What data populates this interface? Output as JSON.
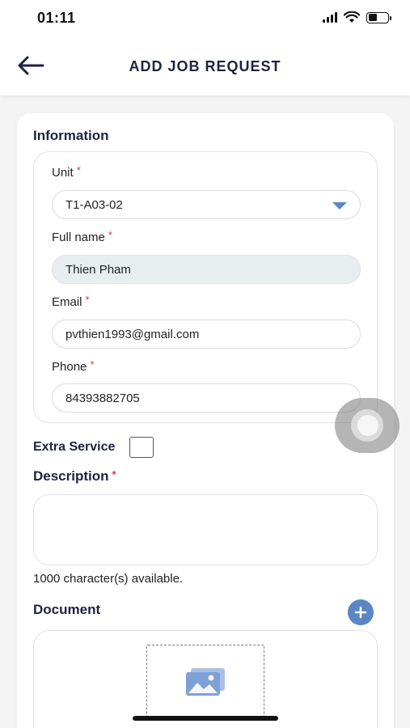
{
  "status_bar": {
    "time": "01:11"
  },
  "header": {
    "title": "ADD JOB REQUEST"
  },
  "form": {
    "information_title": "Information",
    "unit": {
      "label": "Unit",
      "required_mark": "*",
      "value": "T1-A03-02"
    },
    "full_name": {
      "label": "Full name",
      "required_mark": "*",
      "value": "Thien Pham"
    },
    "email": {
      "label": "Email",
      "required_mark": "*",
      "value": "pvthien1993@gmail.com"
    },
    "phone": {
      "label": "Phone",
      "required_mark": "*",
      "value": "84393882705"
    },
    "extra_service": {
      "label": "Extra Service",
      "checked": false
    },
    "description": {
      "label": "Description",
      "required_mark": "*",
      "value": "",
      "char_count_text": "1000 character(s) available."
    },
    "document": {
      "label": "Document"
    }
  },
  "icons": {
    "back": "arrow-left-icon",
    "dropdown": "caret-down-icon",
    "add": "plus-circle-icon",
    "upload": "image-icon"
  },
  "colors": {
    "accent": "#5b86c5",
    "heading": "#1c2340",
    "required": "#e53935",
    "readonly_field": "#e8eef0"
  }
}
